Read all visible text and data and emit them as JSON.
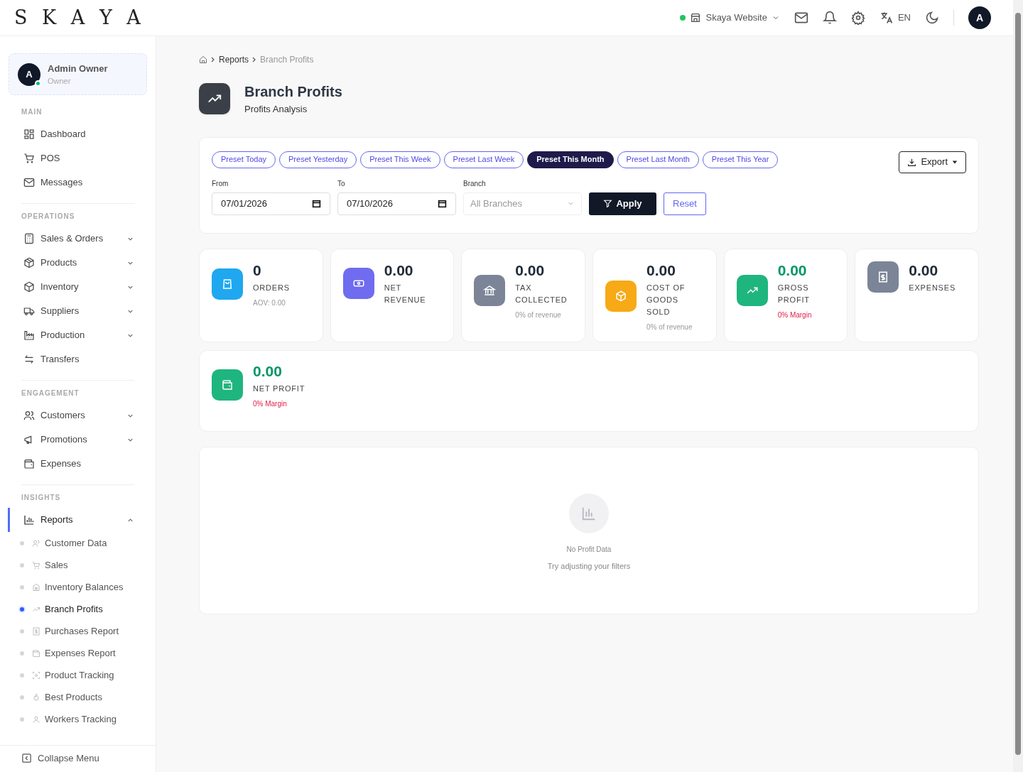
{
  "header": {
    "logo": "S K A Y A",
    "store": {
      "label": "Skaya Website",
      "online": true
    },
    "language": "EN",
    "avatar": "A"
  },
  "sidebar": {
    "user": {
      "initial": "A",
      "name": "Admin Owner",
      "role": "Owner",
      "online": true
    },
    "sections": [
      {
        "title": "MAIN",
        "items": [
          {
            "label": "Dashboard",
            "expandable": false,
            "selected": false
          },
          {
            "label": "POS",
            "expandable": false,
            "selected": false
          },
          {
            "label": "Messages",
            "expandable": false,
            "selected": false
          }
        ]
      },
      {
        "title": "OPERATIONS",
        "items": [
          {
            "label": "Sales & Orders",
            "expandable": true,
            "expanded": false,
            "selected": false
          },
          {
            "label": "Products",
            "expandable": true,
            "expanded": false,
            "selected": false
          },
          {
            "label": "Inventory",
            "expandable": true,
            "expanded": false,
            "selected": false
          },
          {
            "label": "Suppliers",
            "expandable": true,
            "expanded": false,
            "selected": false
          },
          {
            "label": "Production",
            "expandable": true,
            "expanded": false,
            "selected": false
          },
          {
            "label": "Transfers",
            "expandable": false,
            "selected": false
          }
        ]
      },
      {
        "title": "ENGAGEMENT",
        "items": [
          {
            "label": "Customers",
            "expandable": true,
            "expanded": false,
            "selected": false
          },
          {
            "label": "Promotions",
            "expandable": true,
            "expanded": false,
            "selected": false
          },
          {
            "label": "Expenses",
            "expandable": false,
            "selected": false
          }
        ]
      },
      {
        "title": "INSIGHTS",
        "items": [
          {
            "label": "Reports",
            "expandable": true,
            "expanded": true,
            "selected": true,
            "children": [
              {
                "label": "Customer Data",
                "selected": false
              },
              {
                "label": "Sales",
                "selected": false
              },
              {
                "label": "Inventory Balances",
                "selected": false
              },
              {
                "label": "Branch Profits",
                "selected": true
              },
              {
                "label": "Purchases Report",
                "selected": false
              },
              {
                "label": "Expenses Report",
                "selected": false
              },
              {
                "label": "Product Tracking",
                "selected": false
              },
              {
                "label": "Best Products",
                "selected": false
              },
              {
                "label": "Workers Tracking",
                "selected": false
              }
            ]
          }
        ]
      }
    ],
    "collapse": "Collapse Menu"
  },
  "breadcrumb": [
    "Reports",
    "Branch Profits"
  ],
  "page": {
    "title": "Branch Profits",
    "subtitle": "Profits Analysis"
  },
  "filters": {
    "presets": [
      {
        "label": "Preset Today",
        "selected": false
      },
      {
        "label": "Preset Yesterday",
        "selected": false
      },
      {
        "label": "Preset This Week",
        "selected": false
      },
      {
        "label": "Preset Last Week",
        "selected": false
      },
      {
        "label": "Preset This Month",
        "selected": true
      },
      {
        "label": "Preset Last Month",
        "selected": false
      },
      {
        "label": "Preset This Year",
        "selected": false
      }
    ],
    "export": "Export",
    "from": {
      "label": "From",
      "value": "07/01/2026"
    },
    "to": {
      "label": "To",
      "value": "07/10/2026"
    },
    "branch": {
      "label": "Branch",
      "placeholder": "All Branches"
    },
    "apply": "Apply",
    "reset": "Reset"
  },
  "stats": [
    {
      "value": "0",
      "label": "ORDERS",
      "sub": "AOV: 0.00",
      "positive": false,
      "sub_alert": false,
      "color": "#1fa8ef"
    },
    {
      "value": "0.00",
      "label": "NET REVENUE",
      "positive": false,
      "color": "#6f6cf0"
    },
    {
      "value": "0.00",
      "label": "TAX COLLECTED",
      "sub": "0% of revenue",
      "positive": false,
      "sub_alert": false,
      "color": "#7b8597"
    },
    {
      "value": "0.00",
      "label": "COST OF GOODS SOLD",
      "sub": "0% of revenue",
      "positive": false,
      "sub_alert": false,
      "color": "#f7a916"
    },
    {
      "value": "0.00",
      "label": "GROSS PROFIT",
      "sub": "0% Margin",
      "positive": true,
      "sub_alert": true,
      "color": "#1fb57e"
    },
    {
      "value": "0.00",
      "label": "EXPENSES",
      "positive": false,
      "color": "#7b8597"
    }
  ],
  "net_profit": {
    "value": "0.00",
    "label": "NET PROFIT",
    "sub": "0% Margin",
    "positive": true,
    "sub_alert": true,
    "color": "#1fb57e"
  },
  "empty": {
    "title": "No Profit Data",
    "hint": "Try adjusting your filters"
  }
}
